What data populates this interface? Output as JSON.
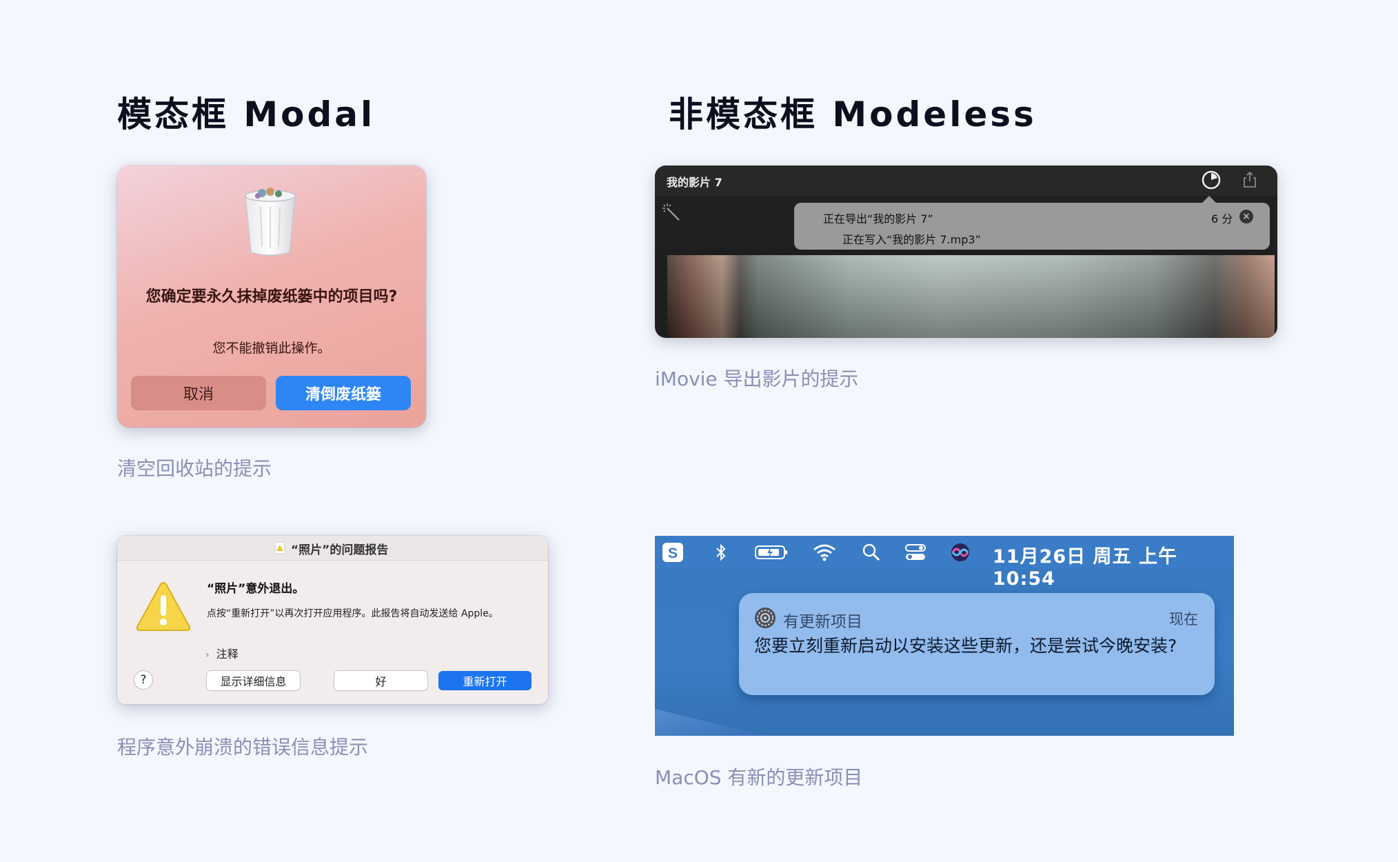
{
  "modal_section": {
    "title": "模态框 Modal",
    "trash_dialog": {
      "message": "您确定要永久抹掉废纸篓中的项目吗?",
      "submessage": "您不能撤销此操作。",
      "cancel_label": "取消",
      "confirm_label": "清倒废纸篓",
      "caption": "清空回收站的提示"
    },
    "crash_dialog": {
      "title": "“照片”的问题报告",
      "heading": "“照片”意外退出。",
      "body": "点按“重新打开”以再次打开应用程序。此报告将自动发送给 Apple。",
      "notes_label": "注释",
      "help_label": "?",
      "details_label": "显示详细信息",
      "ok_label": "好",
      "reopen_label": "重新打开",
      "caption": "程序意外崩溃的错误信息提示"
    }
  },
  "modeless_section": {
    "title": "非模态框 Modeless",
    "imovie": {
      "window_title": "我的影片 7",
      "export_line1": "正在导出“我的影片 7”",
      "export_line2": "正在写入“我的影片 7.mp3”",
      "time_remaining": "6 分",
      "close_label": "×",
      "caption": "iMovie 导出影片的提示"
    },
    "macos": {
      "clock": "11月26日 周五 上午 10:54",
      "notification_app": "有更新项目",
      "notification_time": "现在",
      "notification_body": "您要立刻重新启动以安装这些更新，还是尝试今晚安装?",
      "caption": "MacOS 有新的更新项目"
    }
  },
  "colors": {
    "page_background": "#f4f7fd",
    "caption": "#8a8fb5",
    "primary_button": "#2e86f5",
    "reopen_button": "#1c74f0"
  },
  "icons": [
    "trash-bin-icon",
    "export-progress-icon",
    "share-icon",
    "magic-wand-icon",
    "photos-app-icon",
    "warning-icon",
    "sogou-input-icon",
    "bluetooth-icon",
    "battery-icon",
    "wifi-icon",
    "spotlight-search-icon",
    "control-center-icon",
    "siri-icon",
    "system-preferences-icon"
  ]
}
